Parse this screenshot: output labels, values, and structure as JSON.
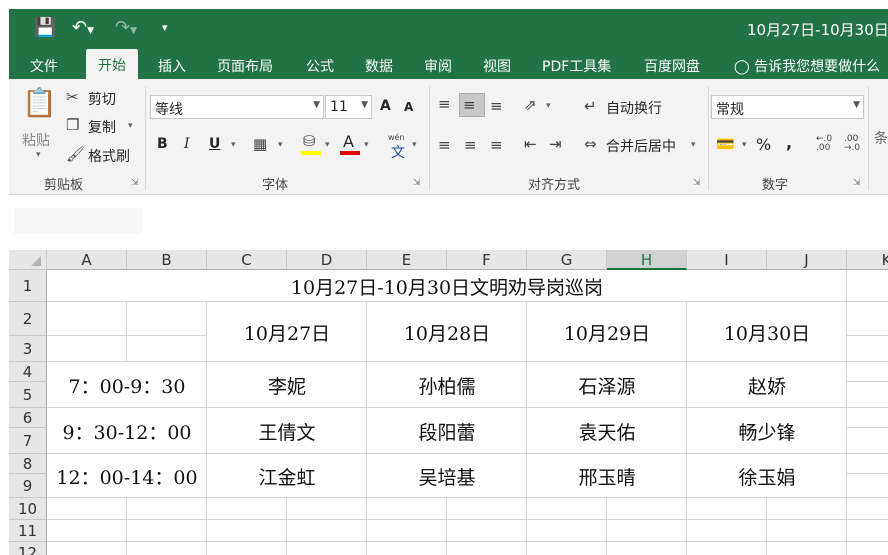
{
  "window": {
    "title": "10月27日-10月30日"
  },
  "qat": {
    "save_icon": "save-icon",
    "undo_icon": "undo-icon",
    "redo_icon": "redo-icon",
    "customize_icon": "customize-icon"
  },
  "tabs": [
    "文件",
    "开始",
    "插入",
    "页面布局",
    "公式",
    "数据",
    "审阅",
    "视图",
    "PDF工具集",
    "百度网盘"
  ],
  "tell_me": "告诉我您想要做什么",
  "clipboard": {
    "paste": "粘贴",
    "cut": "剪切",
    "copy": "复制",
    "format_painter": "格式刷",
    "label": "剪贴板"
  },
  "font": {
    "name": "等线",
    "size": "11",
    "bold": "B",
    "italic": "I",
    "underline": "U",
    "label": "字体",
    "grow": "A",
    "shrink": "A",
    "pinyin_top": "wén",
    "pinyin_char": "文"
  },
  "alignment": {
    "wrap": "自动换行",
    "merge": "合并后居中",
    "label": "对齐方式"
  },
  "number": {
    "format": "常规",
    "percent": "%",
    "comma": ",",
    "inc_decimal": ".0←.00",
    "label": "数字"
  },
  "styles": {
    "cut_label": "条"
  },
  "grid": {
    "columns": [
      "A",
      "B",
      "C",
      "D",
      "E",
      "F",
      "G",
      "H",
      "I",
      "J",
      "K"
    ],
    "selected_column": "H",
    "rows": [
      "1",
      "2",
      "3",
      "4",
      "5",
      "6",
      "7",
      "8",
      "9",
      "10",
      "11",
      "12"
    ],
    "title": "10月27日-10月30日文明劝导岗巡岗",
    "dates": [
      "10月27日",
      "10月28日",
      "10月29日",
      "10月30日"
    ],
    "slots": [
      {
        "time": "7：00-9：30",
        "names": [
          "李妮",
          "孙柏儒",
          "石泽源",
          "赵娇"
        ]
      },
      {
        "time": "9：30-12：00",
        "names": [
          "王倩文",
          "段阳蕾",
          "袁天佑",
          "畅少锋"
        ]
      },
      {
        "time": "12：00-14：00",
        "names": [
          "江金虹",
          "吴培基",
          "邢玉晴",
          "徐玉娟"
        ]
      }
    ]
  },
  "colors": {
    "excel_green": "#217346",
    "ribbon_bg": "#f3f3f3",
    "fill_yellow": "#ffff00",
    "font_red": "#e00000"
  }
}
